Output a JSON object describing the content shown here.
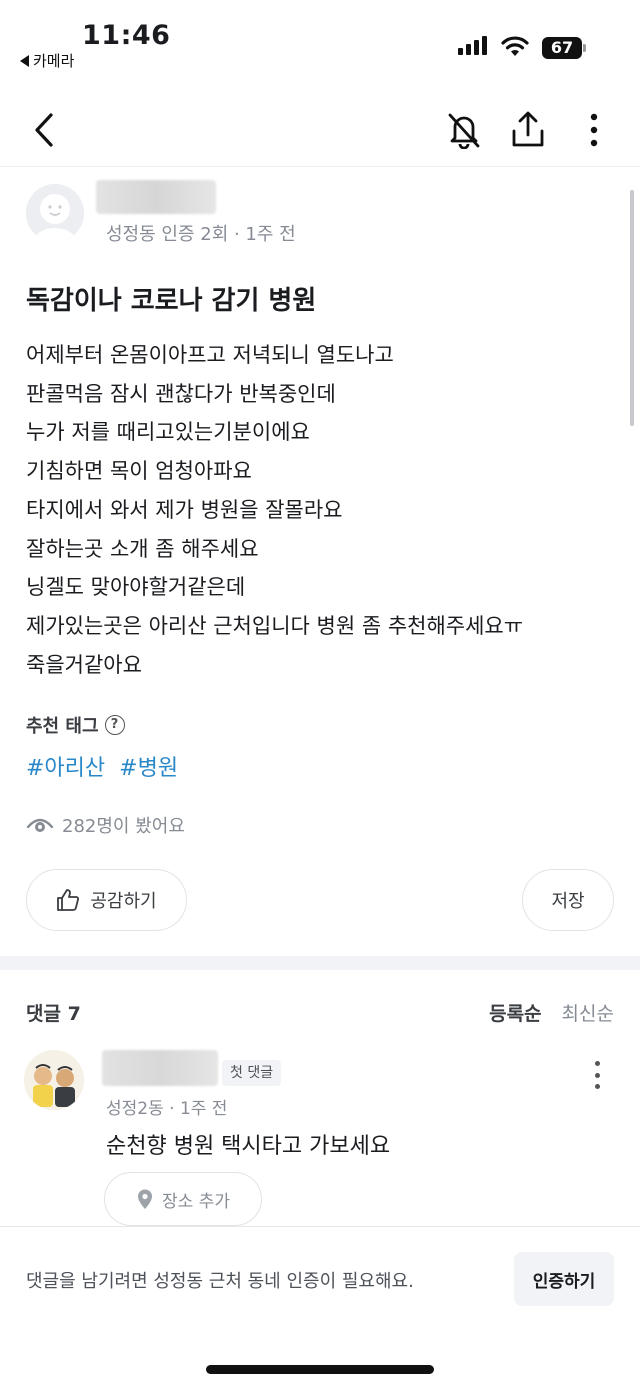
{
  "status": {
    "time": "11:46",
    "back_app": "카메라",
    "battery": "67"
  },
  "nav": {
    "back_icon": "chevron-left-icon",
    "mute_icon": "bell-off-icon",
    "share_icon": "share-icon",
    "more_icon": "more-vertical-icon"
  },
  "post": {
    "author_meta": "성정동 인증 2회 · 1주 전",
    "title": "독감이나 코로나 감기 병원",
    "body": [
      "어제부터 온몸이아프고 저녁되니 열도나고",
      "판콜먹음 잠시 괜찮다가 반복중인데",
      "누가 저를 때리고있는기분이에요",
      "기침하면 목이 엄청아파요",
      "타지에서 와서 제가 병원을 잘몰라요",
      "잘하는곳 소개 좀 해주세요",
      "닝겔도 맞아야할거같은데",
      "제가있는곳은 아리산 근처입니다 병원 좀 추천해주세요ㅠ",
      "죽을거같아요"
    ],
    "tags_label": "추천 태그",
    "tags": [
      "#아리산",
      "#병원"
    ],
    "views": "282명이 봤어요",
    "like_label": "공감하기",
    "save_label": "저장"
  },
  "comments": {
    "count_label": "댓글 7",
    "sort": {
      "registered": "등록순",
      "latest": "최신순"
    },
    "items": [
      {
        "badge": "첫 댓글",
        "meta": "성정2동 · 1주 전",
        "text": "순천향 병원 택시타고 가보세요",
        "place_label": "장소 추가"
      }
    ]
  },
  "bottom": {
    "message": "댓글을 남기려면 성정동 근처 동네 인증이 필요해요.",
    "verify_label": "인증하기"
  },
  "colors": {
    "tag": "#2a88c8",
    "muted": "#868b94",
    "divider": "#f2f3f6"
  }
}
